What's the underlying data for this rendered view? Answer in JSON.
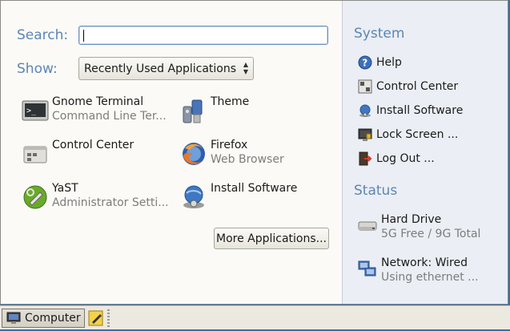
{
  "search": {
    "label": "Search:",
    "value": ""
  },
  "show": {
    "label": "Show:",
    "selected": "Recently Used Applications"
  },
  "apps": [
    {
      "name": "Gnome Terminal",
      "desc": "Command Line Ter...",
      "icon": "terminal-icon"
    },
    {
      "name": "Theme",
      "desc": "",
      "icon": "theme-icon"
    },
    {
      "name": "Control Center",
      "desc": "",
      "icon": "control-center-icon"
    },
    {
      "name": "Firefox",
      "desc": "Web Browser",
      "icon": "firefox-icon"
    },
    {
      "name": "YaST",
      "desc": "Administrator Setti...",
      "icon": "yast-icon"
    },
    {
      "name": "Install Software",
      "desc": "",
      "icon": "install-software-icon"
    }
  ],
  "more_apps_label": "More Applications...",
  "system": {
    "title": "System",
    "items": [
      {
        "label": "Help",
        "icon": "help-icon"
      },
      {
        "label": "Control Center",
        "icon": "control-center-icon"
      },
      {
        "label": "Install Software",
        "icon": "install-software-icon"
      },
      {
        "label": "Lock Screen ...",
        "icon": "lock-screen-icon"
      },
      {
        "label": "Log Out ...",
        "icon": "log-out-icon"
      }
    ]
  },
  "status": {
    "title": "Status",
    "items": [
      {
        "title": "Hard Drive",
        "detail": "5G Free / 9G Total",
        "icon": "hard-drive-icon"
      },
      {
        "title": "Network: Wired",
        "detail": "Using ethernet ...",
        "icon": "network-icon"
      }
    ]
  },
  "taskbar": {
    "computer_label": "Computer"
  },
  "colors": {
    "accent": "#5c86b5",
    "panel": "#ebeef4",
    "menu_bg": "#fbfaf6",
    "desktop": "#3a6ea5"
  }
}
